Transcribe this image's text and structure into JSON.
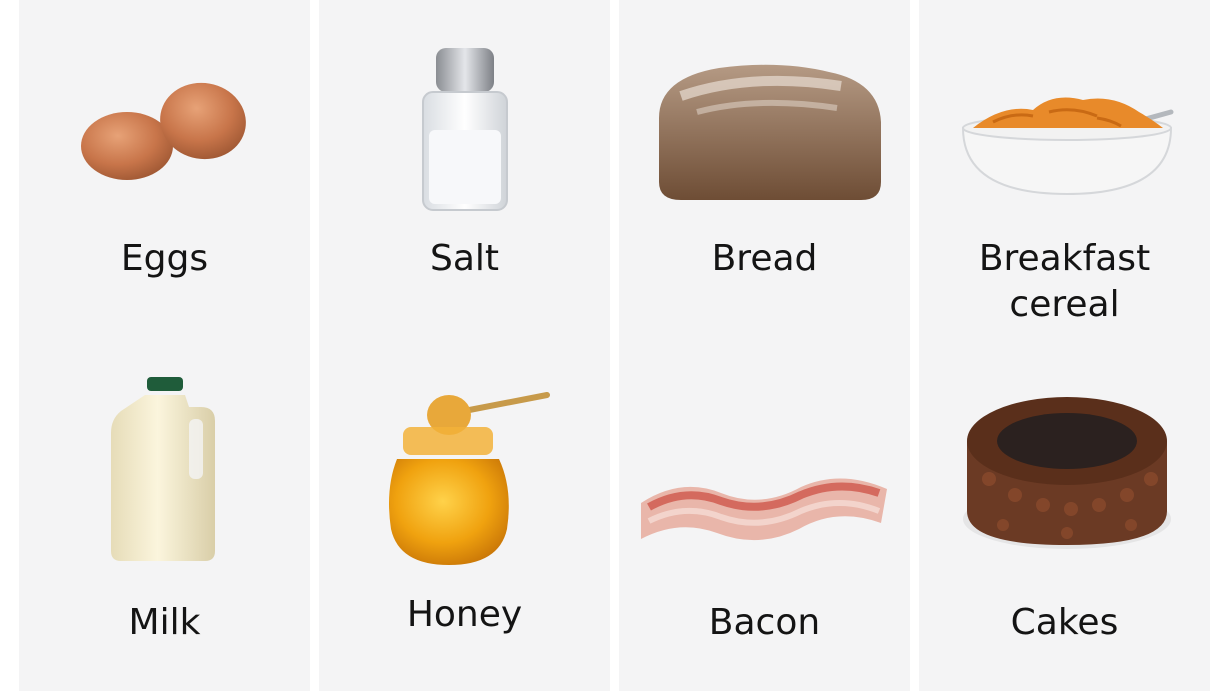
{
  "items": [
    {
      "label": "Eggs",
      "icon": "eggs-icon"
    },
    {
      "label": "Salt",
      "icon": "salt-shaker-icon"
    },
    {
      "label": "Bread",
      "icon": "bread-loaf-icon"
    },
    {
      "label": "Breakfast\ncereal",
      "icon": "cereal-bowl-icon"
    },
    {
      "label": "Milk",
      "icon": "milk-bottle-icon"
    },
    {
      "label": "Honey",
      "icon": "honey-jar-icon"
    },
    {
      "label": "Bacon",
      "icon": "bacon-icon"
    },
    {
      "label": "Cakes",
      "icon": "chocolate-cake-icon"
    }
  ],
  "colors": {
    "panel": "#f4f4f5",
    "gap": "#ffffff",
    "text": "#141414"
  }
}
